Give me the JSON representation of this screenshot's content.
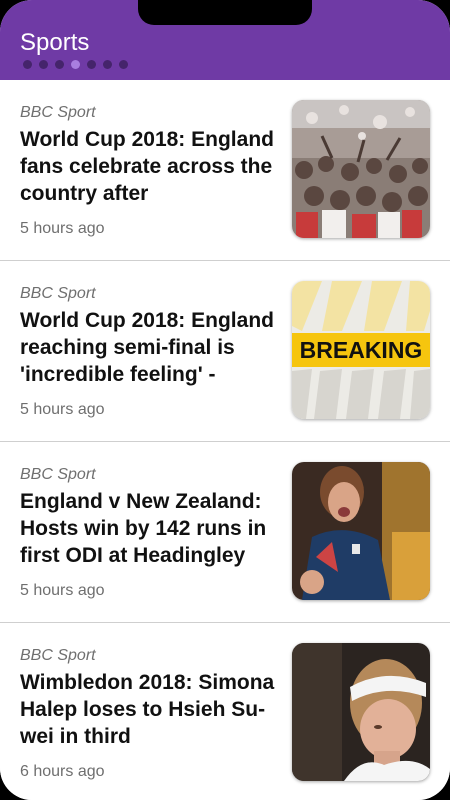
{
  "header": {
    "title": "Sports",
    "page_dots": 7,
    "active_dot": 3
  },
  "colors": {
    "appbar": "#6f3aa5",
    "dot": "#45246b",
    "dot_active": "#a97ee0",
    "breaking_banner": "#f6c50e"
  },
  "articles": [
    {
      "source": "BBC Sport",
      "headline": "World Cup 2018: England fans celebrate across the country after",
      "time": "5 hours ago",
      "thumbnail": "crowd-celebration-photo"
    },
    {
      "source": "BBC Sport",
      "headline": "World Cup 2018: England reaching semi-final is 'incredible feeling' -",
      "time": "5 hours ago",
      "thumbnail": "breaking-news-graphic",
      "thumbnail_text": "BREAKING"
    },
    {
      "source": "BBC Sport",
      "headline": "England v New Zealand: Hosts win by 142 runs in first ODI at Headingley",
      "time": "5 hours ago",
      "thumbnail": "cricketer-celebrating-photo"
    },
    {
      "source": "BBC Sport",
      "headline": "Wimbledon 2018: Simona Halep loses to Hsieh Su-wei in third",
      "time": "6 hours ago",
      "thumbnail": "tennis-player-photo"
    }
  ]
}
